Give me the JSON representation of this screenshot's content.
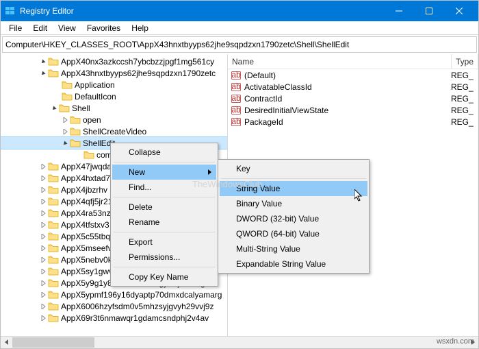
{
  "window": {
    "title": "Registry Editor"
  },
  "menu": {
    "items": [
      "File",
      "Edit",
      "View",
      "Favorites",
      "Help"
    ]
  },
  "address": {
    "path": "Computer\\HKEY_CLASSES_ROOT\\AppX43hnxtbyyps62jhe9sqpdzxn1790zetc\\Shell\\ShellEdit"
  },
  "tree": {
    "nodes": [
      {
        "indent": 56,
        "expander": "open",
        "label": "AppX40nx3azkccsh7ybcbzzjpgf1mg561cy",
        "selected": false
      },
      {
        "indent": 56,
        "expander": "open",
        "label": "AppX43hnxtbyyps62jhe9sqpdzxn1790zetc",
        "selected": false
      },
      {
        "indent": 76,
        "expander": "none",
        "label": "Application",
        "selected": false
      },
      {
        "indent": 76,
        "expander": "none",
        "label": "DefaultIcon",
        "selected": false
      },
      {
        "indent": 72,
        "expander": "open",
        "label": "Shell",
        "selected": false
      },
      {
        "indent": 88,
        "expander": "closed",
        "label": "open",
        "selected": false
      },
      {
        "indent": 88,
        "expander": "closed",
        "label": "ShellCreateVideo",
        "selected": false
      },
      {
        "indent": 88,
        "expander": "open",
        "label": "ShellEdit",
        "selected": true
      },
      {
        "indent": 108,
        "expander": "none",
        "label": "com",
        "selected": false
      },
      {
        "indent": 56,
        "expander": "closed",
        "label": "AppX47jwqda",
        "selected": false
      },
      {
        "indent": 56,
        "expander": "closed",
        "label": "AppX4hxtad7",
        "selected": false
      },
      {
        "indent": 56,
        "expander": "closed",
        "label": "AppX4jbzrhv",
        "selected": false
      },
      {
        "indent": 56,
        "expander": "closed",
        "label": "AppX4qfj5jr21",
        "selected": false
      },
      {
        "indent": 56,
        "expander": "closed",
        "label": "AppX4ra53nz",
        "selected": false
      },
      {
        "indent": 56,
        "expander": "closed",
        "label": "AppX4tfstxv3",
        "selected": false
      },
      {
        "indent": 56,
        "expander": "closed",
        "label": "AppX5c55tbq",
        "selected": false
      },
      {
        "indent": 56,
        "expander": "closed",
        "label": "AppX5mseefv",
        "selected": false
      },
      {
        "indent": 56,
        "expander": "closed",
        "label": "AppX5nebv0k",
        "selected": false
      },
      {
        "indent": 56,
        "expander": "closed",
        "label": "AppX5sy1gwv0tpkexyv44762tbna5r07egk",
        "selected": false
      },
      {
        "indent": 56,
        "expander": "closed",
        "label": "AppX5y9g1y8x8cthhd1nd9gyrmyz0zxtge",
        "selected": false
      },
      {
        "indent": 56,
        "expander": "closed",
        "label": "AppX5ypmf196y16dyaptp70dmxdcalyamarg",
        "selected": false
      },
      {
        "indent": 56,
        "expander": "closed",
        "label": "AppX6006hzyfsdm0v5mhzsyjgvyh29vvj9z",
        "selected": false
      },
      {
        "indent": 56,
        "expander": "closed",
        "label": "AppX69r3t6nmawqr1gdamcsndphj2v4av",
        "selected": false
      }
    ]
  },
  "list": {
    "columns": {
      "name": "Name",
      "type": "Type"
    },
    "rows": [
      {
        "icon": "default",
        "name": "(Default)",
        "type": "REG_"
      },
      {
        "icon": "string",
        "name": "ActivatableClassId",
        "type": "REG_"
      },
      {
        "icon": "string",
        "name": "ContractId",
        "type": "REG_"
      },
      {
        "icon": "string",
        "name": "DesiredInitialViewState",
        "type": "REG_"
      },
      {
        "icon": "string",
        "name": "PackageId",
        "type": "REG_"
      }
    ]
  },
  "context_menu": {
    "items": [
      {
        "label": "Collapse",
        "type": "item"
      },
      {
        "type": "sep"
      },
      {
        "label": "New",
        "type": "submenu",
        "hover": true
      },
      {
        "label": "Find...",
        "type": "item"
      },
      {
        "type": "sep"
      },
      {
        "label": "Delete",
        "type": "item"
      },
      {
        "label": "Rename",
        "type": "item"
      },
      {
        "type": "sep"
      },
      {
        "label": "Export",
        "type": "item"
      },
      {
        "label": "Permissions...",
        "type": "item"
      },
      {
        "type": "sep"
      },
      {
        "label": "Copy Key Name",
        "type": "item"
      }
    ]
  },
  "submenu": {
    "items": [
      {
        "label": "Key",
        "hover": false
      },
      {
        "sep": true
      },
      {
        "label": "String Value",
        "hover": true
      },
      {
        "label": "Binary Value",
        "hover": false
      },
      {
        "label": "DWORD (32-bit) Value",
        "hover": false
      },
      {
        "label": "QWORD (64-bit) Value",
        "hover": false
      },
      {
        "label": "Multi-String Value",
        "hover": false
      },
      {
        "label": "Expandable String Value",
        "hover": false
      }
    ]
  },
  "watermark": "TheWindowsClub",
  "footer": "wsxdn.com"
}
